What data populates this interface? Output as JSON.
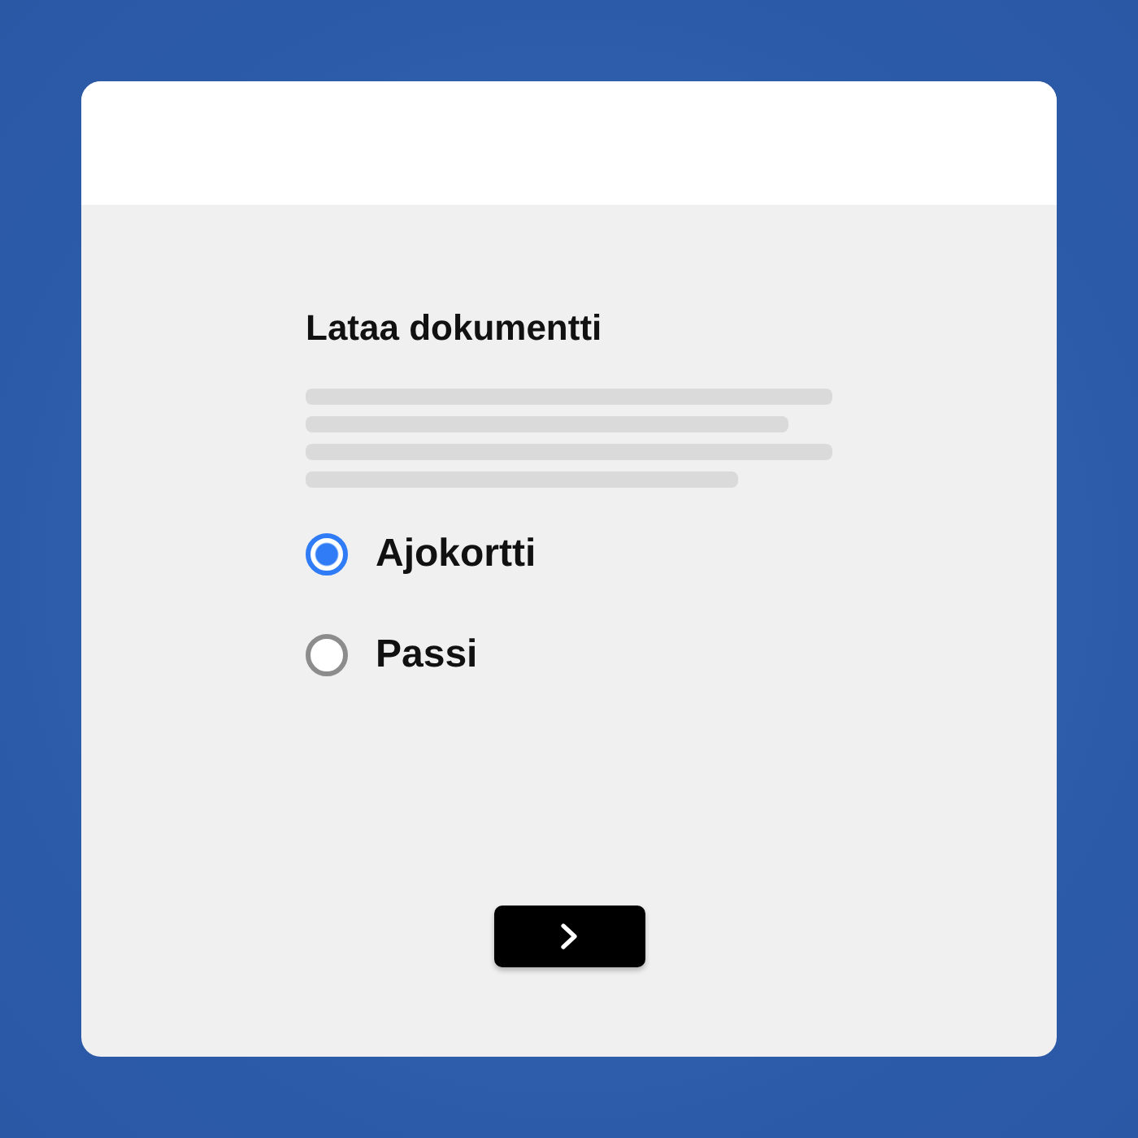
{
  "dialog": {
    "title": "Lataa dokumentti"
  },
  "options": [
    {
      "label": "Ajokortti",
      "selected": true
    },
    {
      "label": "Passi",
      "selected": false
    }
  ]
}
